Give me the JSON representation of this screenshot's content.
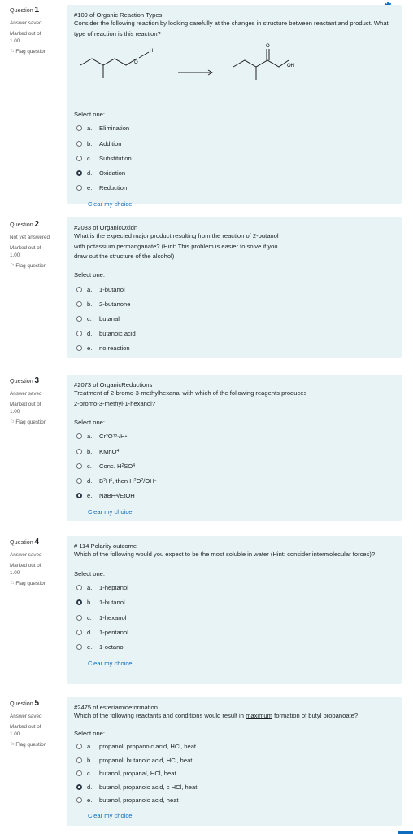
{
  "header": {
    "settings_icon": "gear-icon",
    "caret": "▾"
  },
  "common": {
    "answer_saved": "Answer saved",
    "not_yet": "Not yet answered",
    "marked_out_of": "Marked out of",
    "mark": "1.00",
    "flag": "Flag question",
    "select_one": "Select one:",
    "clear": "Clear my choice",
    "question_word": "Question"
  },
  "questions": [
    {
      "number": "1",
      "state": "Answer saved",
      "title": "#109 of Organic Reaction Types",
      "text": "Consider the following reaction by looking carefully at the changes in structure between reactant and product. What type of reaction is this reaction?",
      "reaction": {
        "left_label": "O",
        "left_h": "H",
        "right_o": "O",
        "right_oh": "OH"
      },
      "options": [
        {
          "letter": "a.",
          "text": "Elimination",
          "selected": false
        },
        {
          "letter": "b.",
          "text": "Addition",
          "selected": false
        },
        {
          "letter": "c.",
          "text": "Substitution",
          "selected": false
        },
        {
          "letter": "d.",
          "text": "Oxidation",
          "selected": true
        },
        {
          "letter": "e.",
          "text": "Reduction",
          "selected": false
        }
      ],
      "clear": "Clear my choice"
    },
    {
      "number": "2",
      "state": "Not yet answered",
      "title": "#2033 of OrganicOxidn",
      "text": "What is the expected major product resulting from the reaction of 2-butanol with potassium permanganate? (Hint: This problem is easier to solve if you draw out the structure of the alcohol)",
      "options": [
        {
          "letter": "a.",
          "text": "1-butanol",
          "selected": false
        },
        {
          "letter": "b.",
          "text": "2-butanone",
          "selected": false
        },
        {
          "letter": "c.",
          "text": "butanal",
          "selected": false
        },
        {
          "letter": "d.",
          "text": "butanoic acid",
          "selected": false
        },
        {
          "letter": "e.",
          "text": "no reaction",
          "selected": false
        }
      ]
    },
    {
      "number": "3",
      "state": "Answer saved",
      "title": "#2073 of OrganicReductions",
      "text": "Treatment of 2-bromo-3-methylhexanal with which of the following reagents produces 2-bromo-3-methyl-1-hexanol?",
      "options": [
        {
          "letter": "a.",
          "parts": [
            "Cr",
            "2",
            "O",
            "7",
            "2-",
            "/H",
            "+"
          ],
          "selected": false
        },
        {
          "letter": "b.",
          "parts": [
            "KMnO",
            "4"
          ],
          "selected": false
        },
        {
          "letter": "c.",
          "parts": [
            "Conc. H",
            "2",
            "SO",
            "4"
          ],
          "selected": false
        },
        {
          "letter": "d.",
          "parts": [
            "B",
            "2",
            "H",
            "6",
            ", then H",
            "2",
            "O",
            "2",
            "/OH",
            "−"
          ],
          "selected": false
        },
        {
          "letter": "e.",
          "parts": [
            "NaBH",
            "4",
            "/EtOH"
          ],
          "selected": true
        }
      ],
      "clear": "Clear my choice"
    },
    {
      "number": "4",
      "state": "Answer saved",
      "title": "# 114 Polarity outcome",
      "text": "Which of the following would you expect to be the most soluble in water (Hint: consider intermolecular forces)?",
      "options": [
        {
          "letter": "a.",
          "text": "1-heptanol",
          "selected": false
        },
        {
          "letter": "b.",
          "text": "1-butanol",
          "selected": true
        },
        {
          "letter": "c.",
          "text": "1-hexanol",
          "selected": false
        },
        {
          "letter": "d.",
          "text": "1-pentanol",
          "selected": false
        },
        {
          "letter": "e.",
          "text": "1-octanol",
          "selected": false
        }
      ],
      "clear": "Clear my choice"
    },
    {
      "number": "5",
      "state": "Answer saved",
      "title": "#2475 of ester/amideformation",
      "text_before": "Which of the following reactants and conditions would result in ",
      "text_underlined": "maximum",
      "text_after": " formation of butyl propanoate?",
      "options": [
        {
          "letter": "a.",
          "text": "propanol, propanoic acid, HCl, heat",
          "selected": false
        },
        {
          "letter": "b.",
          "text": "propanol, butanoic acid, HCl, heat",
          "selected": false
        },
        {
          "letter": "c.",
          "text": "butanol, propanal, HCl, heat",
          "selected": false
        },
        {
          "letter": "d.",
          "text": "butanol, propanoic acid, c HCl, heat",
          "selected": true
        },
        {
          "letter": "e.",
          "text": "butanol, propanoic acid, heat",
          "selected": false
        }
      ],
      "clear": "Clear my choice"
    }
  ]
}
